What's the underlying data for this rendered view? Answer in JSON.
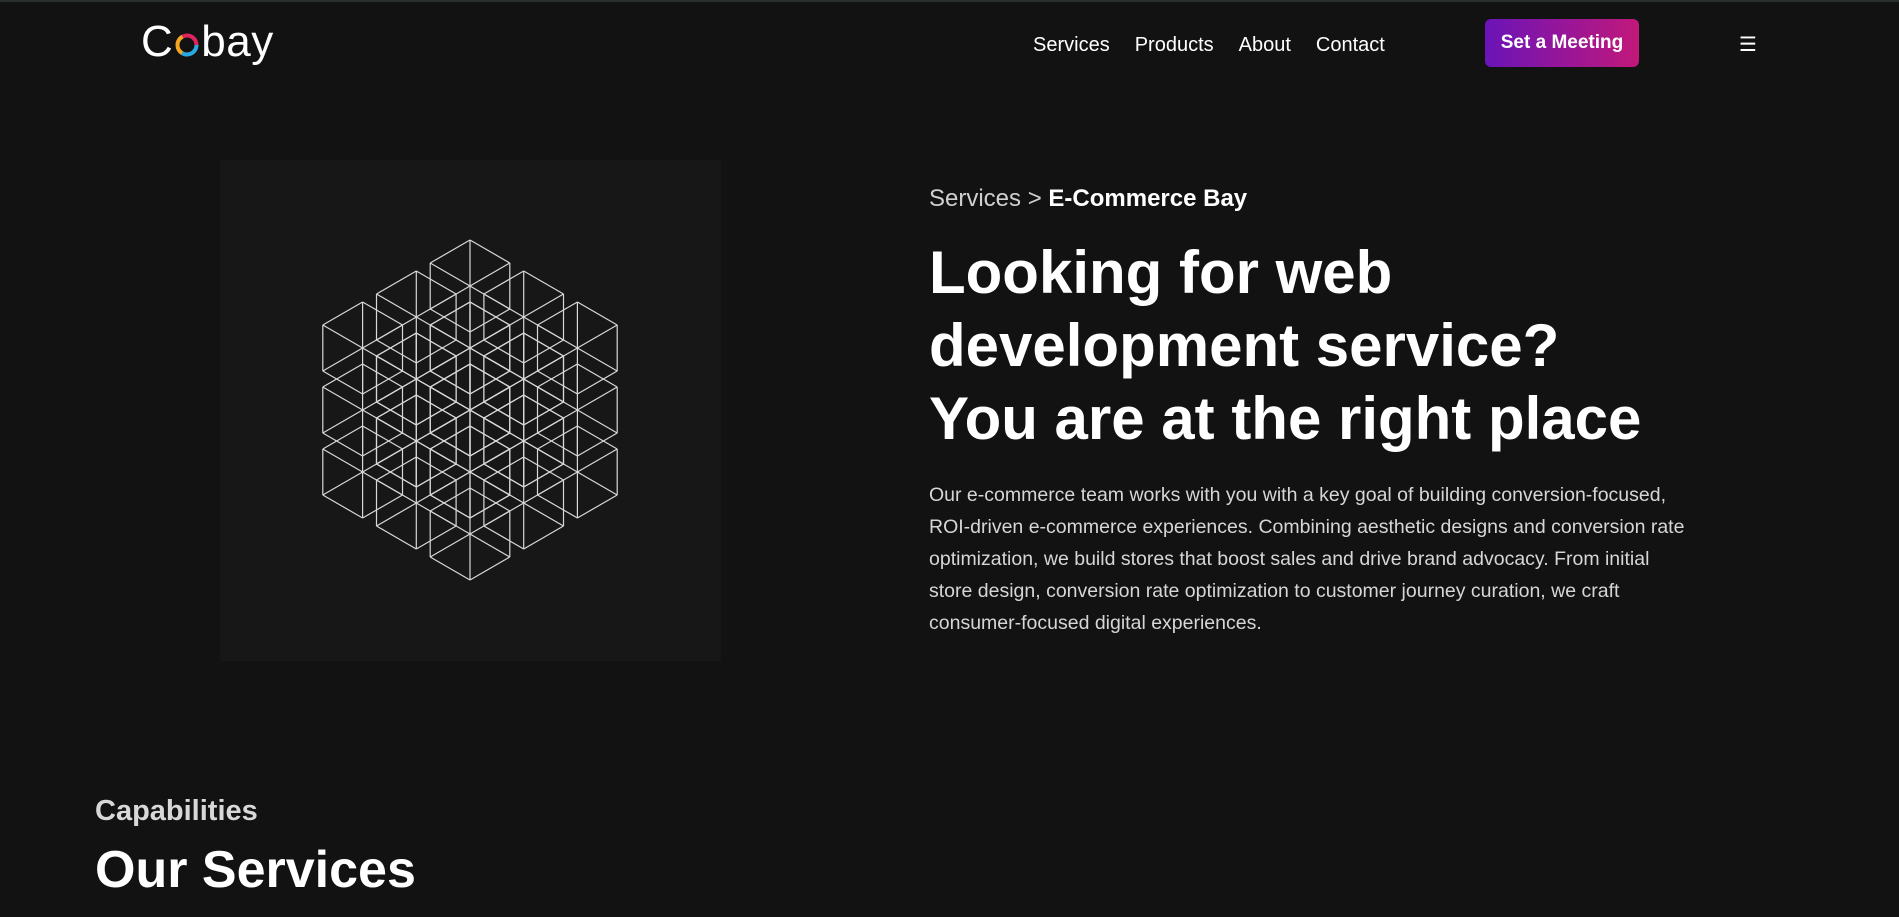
{
  "header": {
    "logo_text_start": "C",
    "logo_text_end": "bay",
    "nav": [
      "Services",
      "Products",
      "About",
      "Contact"
    ],
    "cta_label": "Set a Meeting",
    "menu_icon": "☰"
  },
  "hero": {
    "breadcrumb_parent": "Services",
    "breadcrumb_sep": ">",
    "breadcrumb_current": "E-Commerce Bay",
    "title_lines": [
      "Looking for web",
      "development service?",
      "You are at the right place"
    ],
    "description": "Our e-commerce team works with you with a key goal of building conversion-focused, ROI-driven e-commerce experiences. Combining aesthetic designs and conversion rate optimization, we build stores that boost sales and drive brand advocacy. From initial store design, conversion rate optimization to customer journey curation, we craft consumer-focused digital experiences.",
    "art_icon": "wireframe-cubes-illustration"
  },
  "capabilities": {
    "label": "Capabilities",
    "title": "Our Services"
  },
  "colors": {
    "background": "#121212",
    "cta_gradient_start": "#6a14b8",
    "cta_gradient_end": "#c2187a",
    "logo_ring": [
      "#e0245e",
      "#f5a623",
      "#2aa8e0"
    ]
  }
}
